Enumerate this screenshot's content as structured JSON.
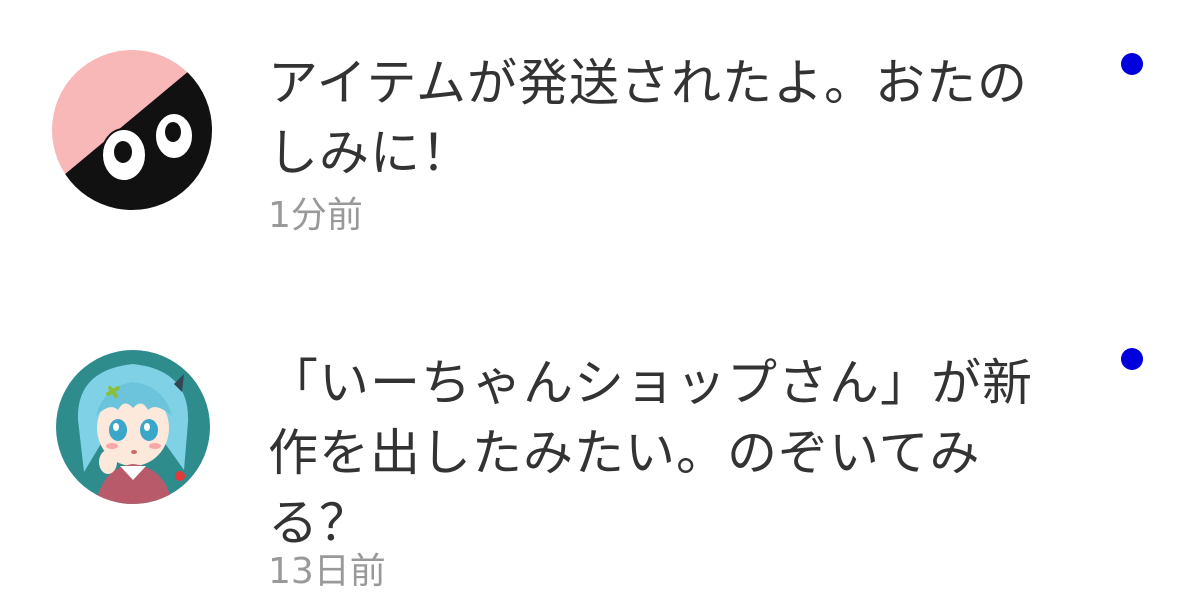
{
  "notifications": [
    {
      "message": "アイテムが発送されたよ。おたのしみに！",
      "time": "1分前",
      "avatar": "black-creature-avatar-icon",
      "unread": true
    },
    {
      "message": "「いーちゃんショップさん」が新作を出したみたい。のぞいてみる？",
      "time": "13日前",
      "avatar": "anime-girl-avatar-icon",
      "unread": true
    }
  ],
  "colors": {
    "unread_dot": "#0000dd",
    "message_text": "#333333",
    "time_text": "#999999",
    "avatar1_bg": "#f8b8b8"
  }
}
